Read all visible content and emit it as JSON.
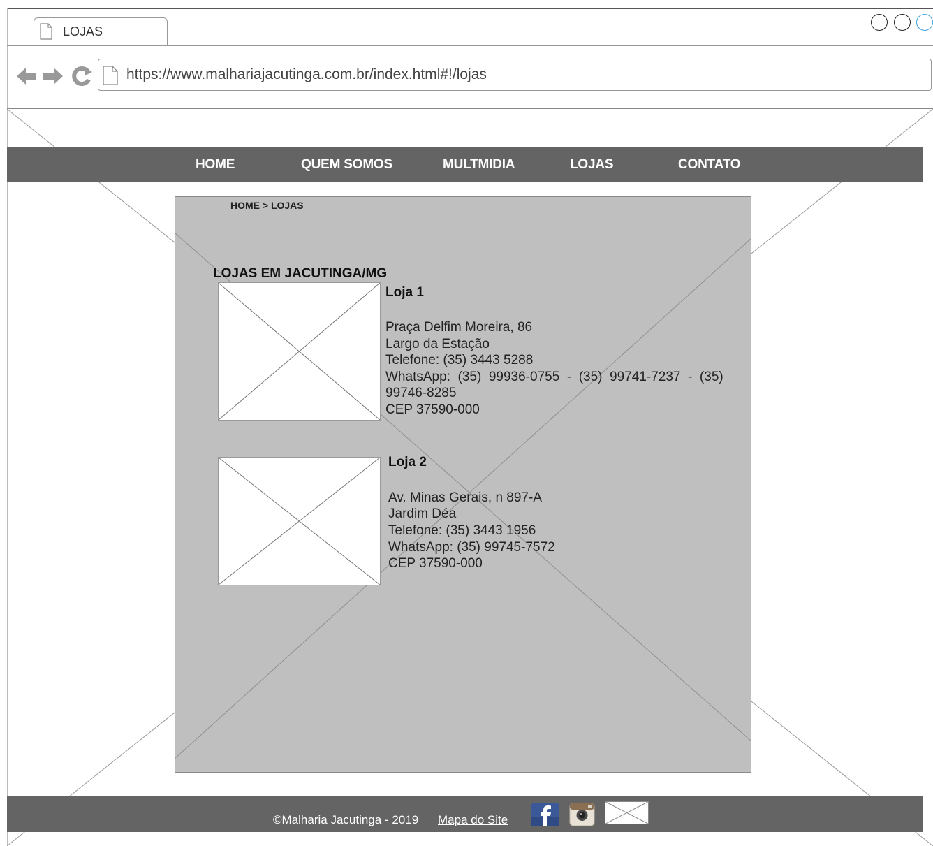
{
  "browser": {
    "tab_title": "LOJAS",
    "url": "https://www.malhariajacutinga.com.br/index.html#!/lojas"
  },
  "nav": {
    "items": [
      {
        "label": "HOME"
      },
      {
        "label": "QUEM SOMOS"
      },
      {
        "label": "MULTMIDIA"
      },
      {
        "label": "LOJAS"
      },
      {
        "label": "CONTATO"
      }
    ]
  },
  "breadcrumb": "HOME > LOJAS",
  "section_title": "LOJAS EM JACUTINGA/MG",
  "stores": [
    {
      "name": "Loja 1",
      "lines": [
        "Praça Delfim Moreira, 86",
        "Largo da Estação",
        "Telefone: (35) 3443 5288",
        "WhatsApp:  (35)  99936-0755  -  (35)  99741-7237  -  (35)",
        "99746-8285",
        "CEP 37590-000"
      ]
    },
    {
      "name": "Loja 2",
      "lines": [
        "Av. Minas Gerais, n 897-A",
        "Jardim Déa",
        "Telefone: (35) 3443 1956",
        "WhatsApp: (35) 99745-7572",
        "CEP 37590-000"
      ]
    }
  ],
  "footer": {
    "copyright": "©Malharia Jacutinga - 2019",
    "sitemap_link": "Mapa do Site"
  },
  "colors": {
    "navbar_bg": "#646464",
    "content_bg": "#bfbfbf",
    "facebook_blue": "#3b5998"
  }
}
